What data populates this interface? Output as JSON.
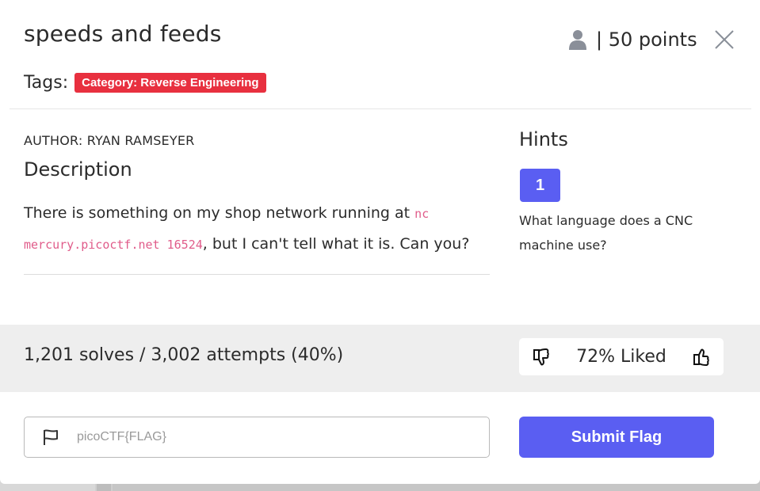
{
  "header": {
    "title": "speeds and feeds",
    "points": "| 50 points",
    "tags_label": "Tags:",
    "tag": "Category: Reverse Engineering"
  },
  "challenge": {
    "author": "AUTHOR: RYAN RAMSEYER",
    "description_heading": "Description",
    "description_before": "There is something on my shop network running at ",
    "description_code": "nc mercury.picoctf.net 16524",
    "description_after": ", but I can't tell what it is. Can you?"
  },
  "hints": {
    "heading": "Hints",
    "items": [
      {
        "label": "1",
        "text": "What language does a CNC machine use?"
      }
    ]
  },
  "stats": {
    "solves": "1,201 solves / 3,002 attempts (40%)",
    "liked": "72% Liked"
  },
  "flag_form": {
    "placeholder": "picoCTF{FLAG}",
    "value": "",
    "submit_label": "Submit Flag"
  },
  "icons": {
    "user": "user-icon",
    "close": "close-icon",
    "thumbs_down": "thumbs-down-icon",
    "thumbs_up": "thumbs-up-icon",
    "flag": "flag-icon"
  },
  "colors": {
    "accent": "#5a5ef2",
    "tag_red": "#e8303f",
    "code_pink": "#e05c8a",
    "stats_band": "#eeeeee"
  }
}
